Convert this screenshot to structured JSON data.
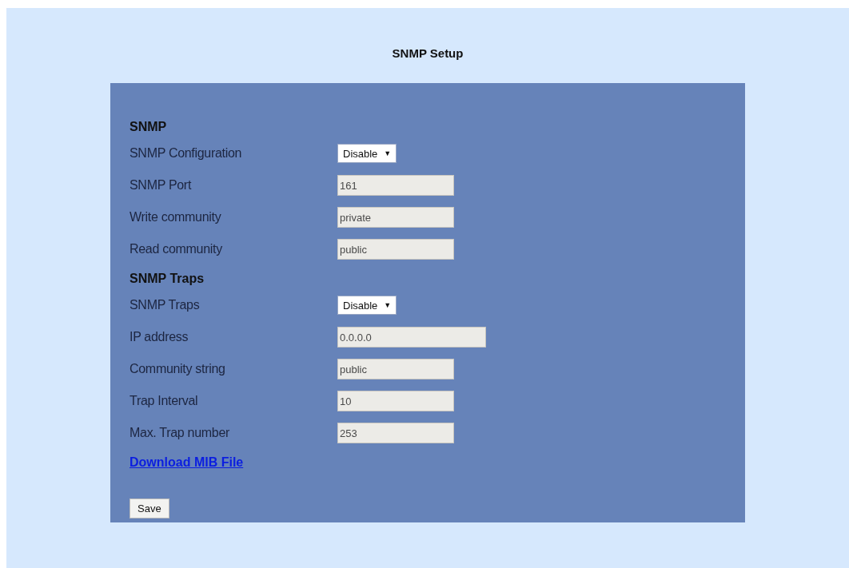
{
  "page_title": "SNMP Setup",
  "sections": [
    {
      "heading": "SNMP",
      "rows": [
        {
          "kind": "select",
          "label": "SNMP Configuration",
          "value": "Disable",
          "caret": "▼",
          "disabled": false
        },
        {
          "kind": "text",
          "label": "SNMP Port",
          "value": "161",
          "disabled": true
        },
        {
          "kind": "text",
          "label": "Write community",
          "value": "private",
          "disabled": true
        },
        {
          "kind": "text",
          "label": "Read community",
          "value": "public",
          "disabled": true
        }
      ]
    },
    {
      "heading": "SNMP Traps",
      "rows": [
        {
          "kind": "select",
          "label": "SNMP Traps",
          "value": "Disable",
          "caret": "▼",
          "disabled": false
        },
        {
          "kind": "wide",
          "label": "IP address",
          "value": "0.0.0.0",
          "disabled": true
        },
        {
          "kind": "text",
          "label": "Community string",
          "value": "public",
          "disabled": true
        },
        {
          "kind": "text",
          "label": "Trap Interval",
          "value": "10",
          "disabled": true
        },
        {
          "kind": "text",
          "label": "Max. Trap number",
          "value": "253",
          "disabled": true
        }
      ]
    }
  ],
  "download_link": "Download MIB File",
  "save_button": "Save"
}
